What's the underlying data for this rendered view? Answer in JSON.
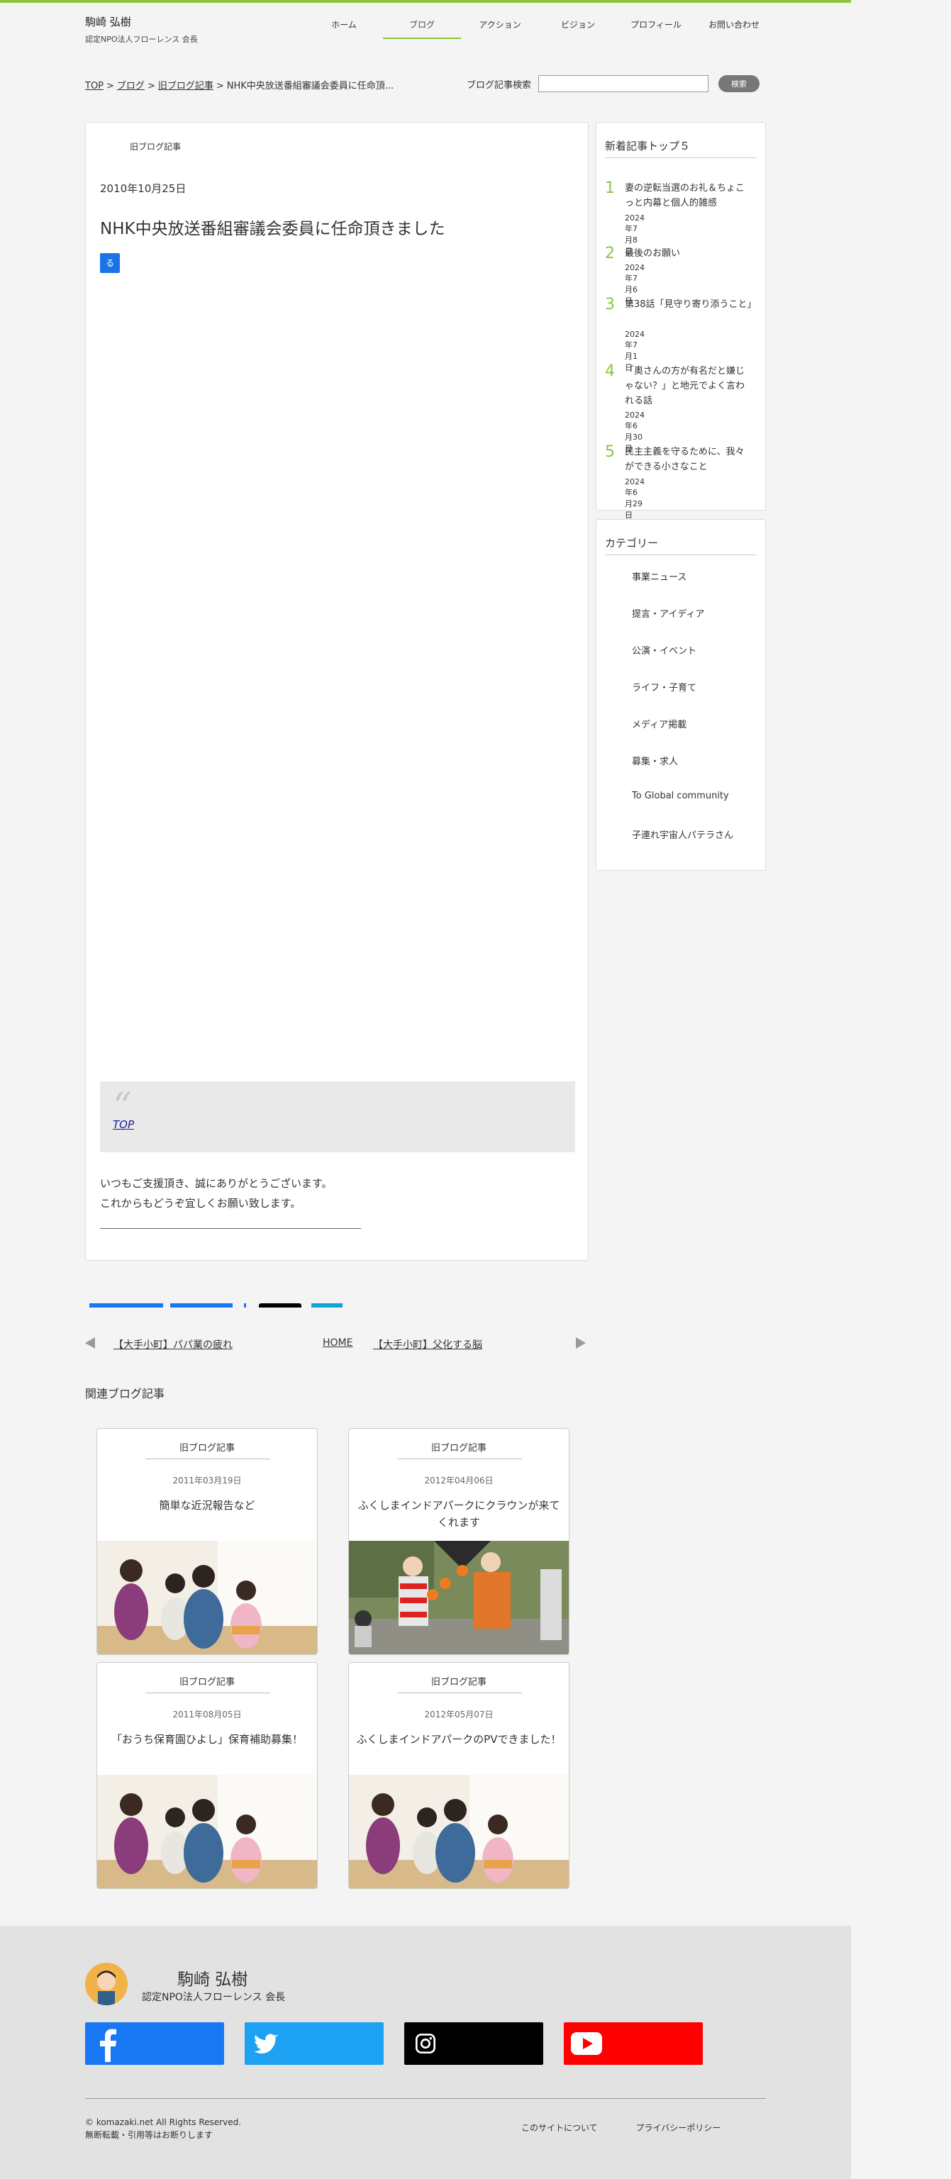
{
  "header": {
    "site_name": "駒崎 弘樹",
    "site_sub": "認定NPO法人フローレンス 会長",
    "nav": [
      "ホーム",
      "ブログ",
      "アクション",
      "ビジョン",
      "プロフィール",
      "お問い合わせ"
    ],
    "active_nav": "ブログ"
  },
  "breadcrumb": {
    "top": "TOP",
    "blog": "ブログ",
    "old": "旧ブログ記事",
    "current": "NHK中央放送番組審議会委員に任命頂...",
    "sep": ">"
  },
  "search": {
    "label": "ブログ記事検索",
    "button": "検索",
    "placeholder": ""
  },
  "article": {
    "category": "旧ブログ記事",
    "date": "2010年10月25日",
    "title": "NHK中央放送番組審議会委員に任命頂きました",
    "badge": "る",
    "quote_link": "TOP",
    "closing_line1": "いつもご支援頂き、誠にありがとうございます。",
    "closing_line2": "これからもどうぞ宜しくお願い致します。"
  },
  "top5": {
    "heading": "新着記事トップ５",
    "items": [
      {
        "num": "1",
        "title": "妻の逆転当選のお礼＆ちょこっと内幕と個人的雑感",
        "date": "2024年7月8日"
      },
      {
        "num": "2",
        "title": "最後のお願い",
        "date": "2024年7月6日"
      },
      {
        "num": "3",
        "title": "第38話「見守り寄り添うこと」",
        "date": "2024年7月1日"
      },
      {
        "num": "4",
        "title": "「奥さんの方が有名だと嫌じゃない？」と地元でよく言われる話",
        "date": "2024年6月30日"
      },
      {
        "num": "5",
        "title": "民主主義を守るために、我々ができる小さなこと",
        "date": "2024年6月29日"
      }
    ]
  },
  "categories": {
    "heading": "カテゴリー",
    "items": [
      "事業ニュース",
      "提言・アイディア",
      "公演・イベント",
      "ライフ・子育て",
      "メディア掲載",
      "募集・求人",
      "To Global community",
      "子連れ宇宙人パテラさん"
    ]
  },
  "pager": {
    "prev": "【大手小町】パパ業の疲れ",
    "home": "HOME",
    "next": "【大手小町】父化する脳"
  },
  "related": {
    "heading": "関連ブログ記事",
    "cards": [
      {
        "category": "旧ブログ記事",
        "date": "2011年03月19日",
        "title": "簡単な近況報告など",
        "image": "children-playing"
      },
      {
        "category": "旧ブログ記事",
        "date": "2012年04月06日",
        "title": "ふくしまインドアパークにクラウンが来てくれます",
        "image": "clowns-juggling"
      },
      {
        "category": "旧ブログ記事",
        "date": "2011年08月05日",
        "title": "「おうち保育園ひよし」保育補助募集！",
        "image": "children-playing"
      },
      {
        "category": "旧ブログ記事",
        "date": "2012年05月07日",
        "title": "ふくしまインドアパークのPVできました！",
        "image": "children-playing"
      }
    ]
  },
  "footer": {
    "name": "駒崎 弘樹",
    "sub": "認定NPO法人フローレンス 会長",
    "sns": [
      {
        "name": "facebook",
        "color": "#1877f2"
      },
      {
        "name": "twitter",
        "color": "#1da1f2"
      },
      {
        "name": "instagram",
        "color": "#000000"
      },
      {
        "name": "youtube",
        "color": "#ff0000"
      }
    ],
    "copyright": "© komazaki.net All Rights Reserved.",
    "notice": "無断転載・引用等はお断りします",
    "links": [
      "このサイトについて",
      "プライバシーポリシー"
    ]
  },
  "colors": {
    "accent": "#8cc63f"
  }
}
